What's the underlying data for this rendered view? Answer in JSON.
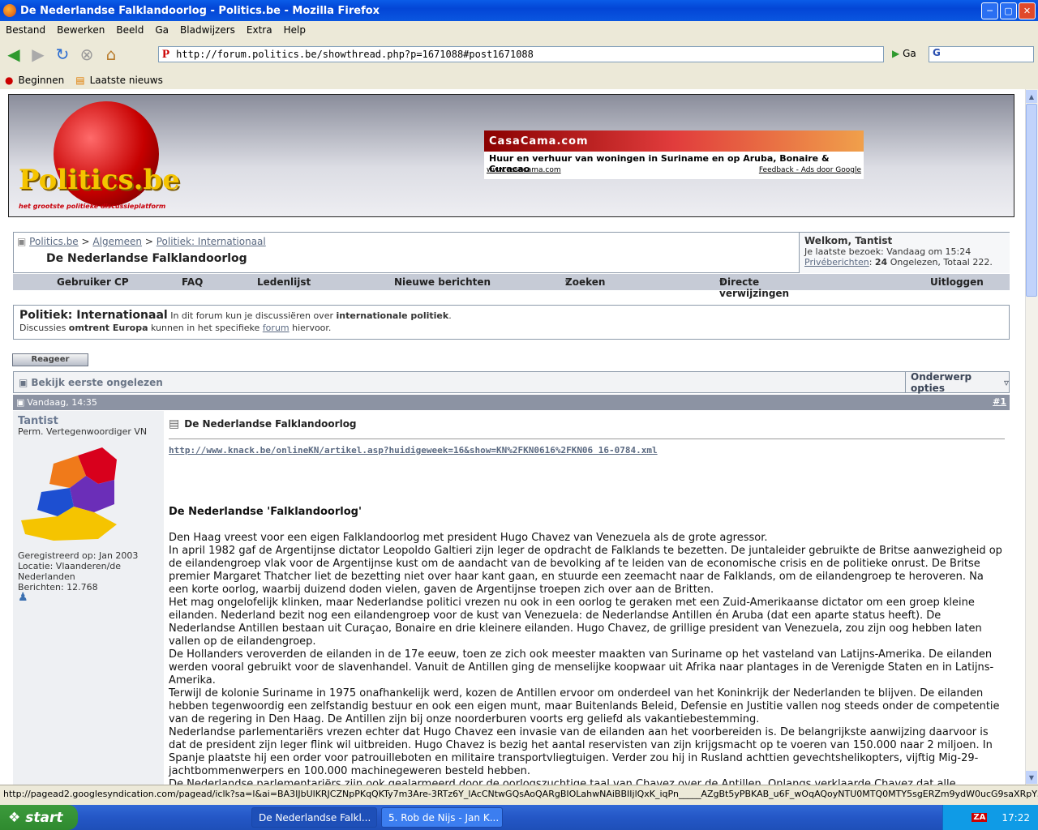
{
  "window": {
    "title": "De Nederlandse Falklandoorlog - Politics.be - Mozilla Firefox"
  },
  "menu": [
    "Bestand",
    "Bewerken",
    "Beeld",
    "Ga",
    "Bladwijzers",
    "Extra",
    "Help"
  ],
  "nav": {
    "url": "http://forum.politics.be/showthread.php?p=1671088#post1671088",
    "go_label": "Ga",
    "search_letter": "G"
  },
  "bookmarks": [
    "Beginnen",
    "Laatste nieuws"
  ],
  "banner": {
    "logo": "Politics.be",
    "tagline": "het grootste politieke discussieplatform",
    "ad_title": "CasaCama.com",
    "ad_text": "Huur en verhuur van woningen in Suriname en op Aruba, Bonaire & Curacao",
    "ad_url": "www.casacama.com",
    "ad_feedback": "Feedback - Ads door Google"
  },
  "breadcrumb": {
    "items": [
      "Politics.be",
      "Algemeen",
      "Politiek: Internationaal"
    ],
    "sep": ">",
    "title": "De Nederlandse Falklandoorlog"
  },
  "welcome": {
    "greeting": "Welkom, Tantist",
    "last_visit": "Je laatste bezoek: Vandaag om 15:24",
    "pm_label": "Privéberichten",
    "pm_count": "24",
    "pm_rest": "Ongelezen, Totaal 222."
  },
  "navrow": [
    "Gebruiker CP",
    "FAQ",
    "Ledenlijst",
    "Nieuwe berichten",
    "Zoeken",
    "Directe verwijzingen",
    "Uitloggen"
  ],
  "forum": {
    "name": "Politiek: Internationaal",
    "desc1": "In dit forum kun je discussiëren over",
    "desc1b": "internationale politiek",
    "desc1c": ".",
    "desc2a": "Discussies",
    "desc2b": "omtrent Europa",
    "desc2c": "kunnen in het specifieke",
    "desc2link": "forum",
    "desc2d": "hiervoor."
  },
  "buttons": {
    "reply": "Reageer",
    "first_unread": "Bekijk eerste ongelezen",
    "options": "Onderwerp opties"
  },
  "post": {
    "date": "Vandaag, 14:35",
    "number": "#1",
    "title": "De Nederlandse Falklandoorlog",
    "link": "http://www.knack.be/onlineKN/artikel.asp?huidigeweek=16&show=KN%2FKN0616%2FKN06 16-0784.xml",
    "heading": "De Nederlandse 'Falklandoorlog'",
    "paragraphs": [
      "Den Haag vreest voor een eigen Falklandoorlog met president Hugo Chavez van Venezuela als de grote agressor.",
      "In april 1982 gaf de Argentijnse dictator Leopoldo Galtieri zijn leger de opdracht de Falklands te bezetten. De juntaleider gebruikte de Britse aanwezigheid op de eilandengroep vlak voor de Argentijnse kust om de aandacht van de bevolking af te leiden van de economische crisis en de politieke onrust. De Britse premier Margaret Thatcher liet de bezetting niet over haar kant gaan, en stuurde een zeemacht naar de Falklands, om de eilandengroep te heroveren. Na een korte oorlog, waarbij duizend doden vielen, gaven de Argentijnse troepen zich over aan de Britten.",
      "Het mag ongelofelijk klinken, maar Nederlandse politici vrezen nu ook in een oorlog te geraken met een Zuid-Amerikaanse dictator om een groep kleine eilanden. Nederland bezit nog een eilandengroep voor de kust van Venezuela: de Nederlandse Antillen én Aruba (dat een aparte status heeft). De Nederlandse Antillen bestaan uit Curaçao, Bonaire en drie kleinere eilanden. Hugo Chavez, de grillige president van Venezuela, zou zijn oog hebben laten vallen op de eilandengroep.",
      "De Hollanders veroverden de eilanden in de 17e eeuw, toen ze zich ook meester maakten van Suriname op het vasteland van Latijns-Amerika. De eilanden werden vooral gebruikt voor de slavenhandel. Vanuit de Antillen ging de menselijke koopwaar uit Afrika naar plantages in de Verenigde Staten en in Latijns-Amerika.",
      "Terwijl de kolonie Suriname in 1975 onafhankelijk werd, kozen de Antillen ervoor om onderdeel van het Koninkrijk der Nederlanden te blijven. De eilanden hebben tegenwoordig een zelfstandig bestuur en ook een eigen munt, maar Buitenlands Beleid, Defensie en Justitie vallen nog steeds onder de competentie van de regering in Den Haag. De Antillen zijn bij onze noorderburen voorts erg geliefd als vakantiebestemming.",
      "Nederlandse parlementariërs vrezen echter dat Hugo Chavez een invasie van de eilanden aan het voorbereiden is. De belangrijkste aanwijzing daarvoor is dat de president zijn leger flink wil uitbreiden. Hugo Chavez is bezig het aantal reservisten van zijn krijgsmacht op te voeren van 150.000 naar 2 miljoen. In Spanje plaatste hij een order voor patrouilleboten en militaire transportvliegtuigen. Verder zou hij in Rusland achttien gevechtshelikopters, vijftig Mig-29-jachtbommenwerpers en 100.000 machinegeweren besteld hebben.",
      "De Nederlandse parlementariërs zijn ook gealarmeerd door de oorlogszuchtige taal van Chavez over de Antillen. Onlangs verklaarde Chavez dat alle"
    ]
  },
  "user": {
    "name": "Tantist",
    "title": "Perm. Vertegenwoordiger VN",
    "registered": "Geregistreerd op: Jan 2003",
    "location": "Locatie: Vlaanderen/de Nederlanden",
    "posts": "Berichten: 12.768"
  },
  "status": "http://pagead2.googlesyndication.com/pagead/iclk?sa=l&ai=BA3IJbUlKRJCZNpPKqQKTy7m3Are-3RTz6Y_lAcCNtwGQsAoQARgBIOLahwNAiBBIIjlQxK_iqPn_____AZgBt5yPBKAB_u6F_wOqAQoyNTU0MTQ0MTY5sgERZm9ydW0ucG9saXRpY3MuYmW6AQk0NjhnNjBf...",
  "taskbar": {
    "start": "start",
    "tasks": [
      "De Nederlandse Falkl...",
      "5. Rob de Nijs - Jan K..."
    ],
    "time": "17:22",
    "lang": "ZA"
  }
}
